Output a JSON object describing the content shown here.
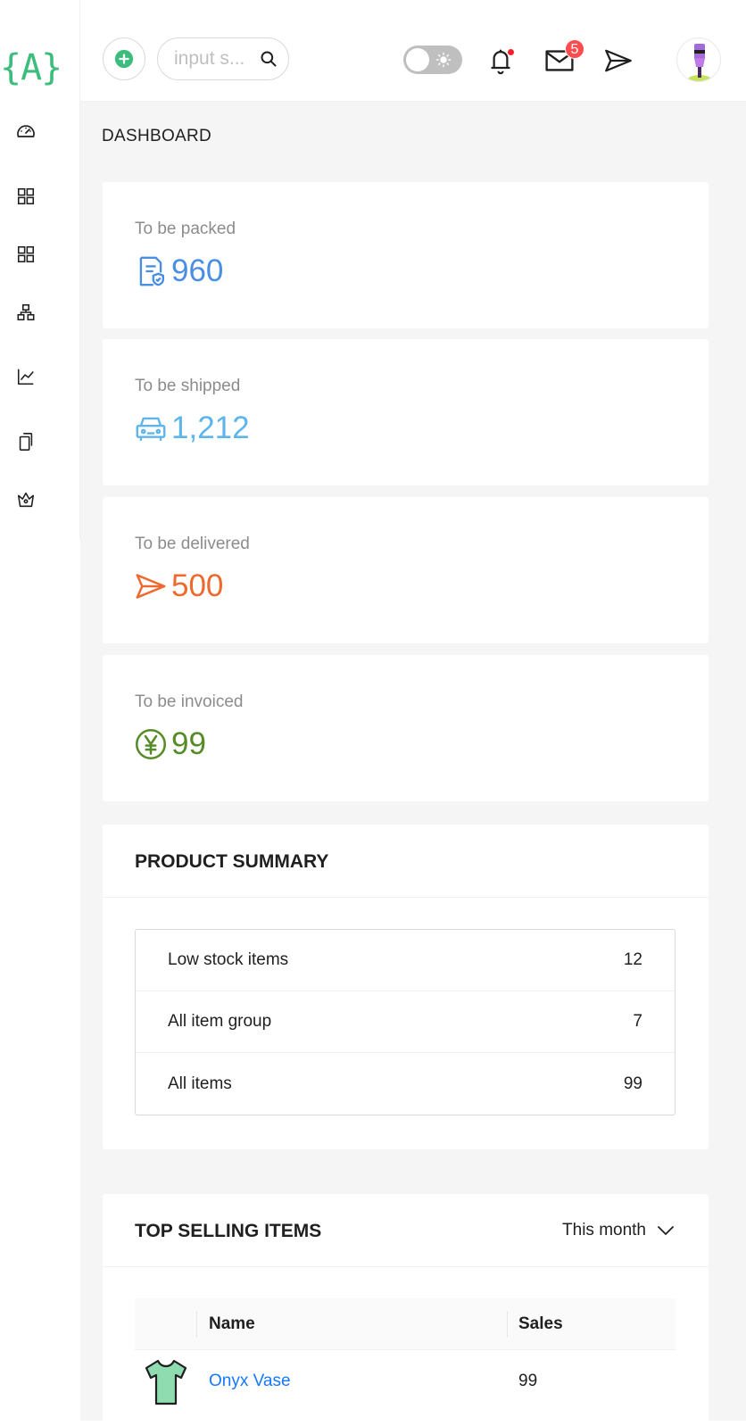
{
  "logo": {
    "text": "{A}"
  },
  "sidebar": {
    "items": [
      {
        "icon": "dashboard-icon"
      },
      {
        "icon": "appstore-icon"
      },
      {
        "icon": "appstore-icon"
      },
      {
        "icon": "cluster-icon"
      },
      {
        "icon": "line-chart-icon"
      },
      {
        "icon": "copy-icon"
      },
      {
        "icon": "crown-icon"
      }
    ]
  },
  "header": {
    "search_placeholder": "input s...",
    "notification_dot": true,
    "mail_badge": "5"
  },
  "page_title": "DASHBOARD",
  "stats": [
    {
      "label": "To be packed",
      "value": "960",
      "color": "#4a8ee4",
      "icon": "file-protect-icon"
    },
    {
      "label": "To be shipped",
      "value": "1,212",
      "color": "#5db5eb",
      "icon": "car-icon"
    },
    {
      "label": "To be delivered",
      "value": "500",
      "color": "#ed6a2f",
      "icon": "send-icon"
    },
    {
      "label": "To be invoiced",
      "value": "99",
      "color": "#568c28",
      "icon": "yen-circle-icon"
    }
  ],
  "product_summary": {
    "title": "PRODUCT SUMMARY",
    "rows": [
      {
        "label": "Low stock items",
        "value": "12"
      },
      {
        "label": "All item group",
        "value": "7"
      },
      {
        "label": "All items",
        "value": "99"
      }
    ]
  },
  "top_selling": {
    "title": "TOP SELLING ITEMS",
    "period": "This month",
    "columns": {
      "name": "Name",
      "sales": "Sales"
    },
    "rows": [
      {
        "name": "Onyx Vase",
        "sales": "99",
        "icon": "tshirt-icon"
      }
    ]
  }
}
